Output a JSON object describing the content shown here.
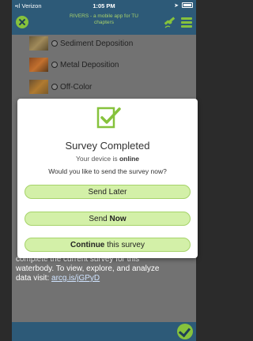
{
  "status_bar": {
    "carrier": "Verizon",
    "time": "1:05 PM"
  },
  "app_bar": {
    "title_line1": "RIVERS - a mobile app for TU",
    "title_line2": "chapters"
  },
  "list": [
    {
      "label": "Sediment Deposition"
    },
    {
      "label": "Metal Deposition"
    },
    {
      "label": "Off-Color"
    }
  ],
  "background_text": {
    "line1": "complete the current survey for this",
    "line2": "waterbody. To view, explore, and analyze",
    "line3_prefix": "data visit: ",
    "link": "arcg.is/jGPyD"
  },
  "dialog": {
    "title": "Survey Completed",
    "status_prefix": "Your device is ",
    "status_value": "online",
    "question": "Would you like to send the survey now?",
    "send_later": "Send Later",
    "send_now_prefix": "Send ",
    "send_now_bold": "Now",
    "continue_bold": "Continue",
    "continue_suffix": " this survey"
  },
  "colors": {
    "accent_green": "#86c23c",
    "bar_blue": "#2d5a78",
    "button_fill": "#d3f0a8"
  }
}
